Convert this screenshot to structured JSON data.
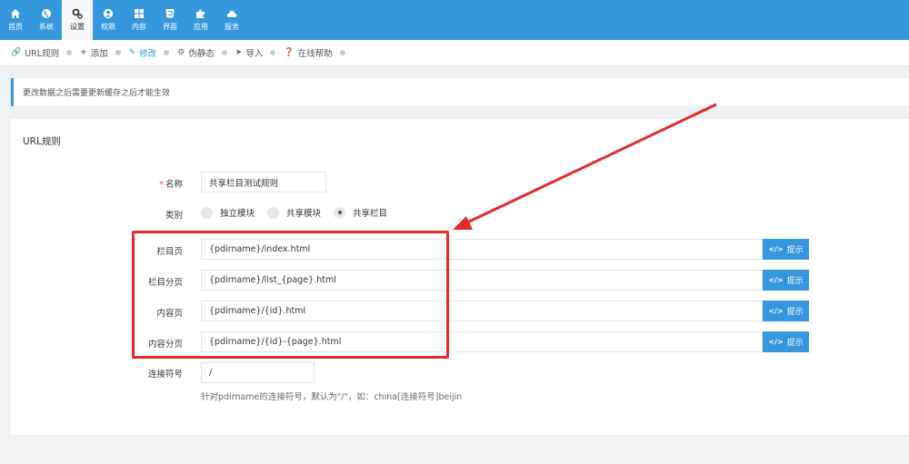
{
  "nav": {
    "items": [
      {
        "label": "首页",
        "icon": "home-icon"
      },
      {
        "label": "系统",
        "icon": "globe-icon"
      },
      {
        "label": "设置",
        "icon": "gears-icon",
        "active": true
      },
      {
        "label": "权限",
        "icon": "user-icon"
      },
      {
        "label": "内容",
        "icon": "grid-icon"
      },
      {
        "label": "界面",
        "icon": "html5-icon"
      },
      {
        "label": "应用",
        "icon": "puzzle-icon"
      },
      {
        "label": "服务",
        "icon": "cloud-icon"
      }
    ]
  },
  "toolbar": {
    "items": [
      {
        "label": "URL规则",
        "icon": "link-icon"
      },
      {
        "label": "添加",
        "icon": "plus-icon"
      },
      {
        "label": "修改",
        "icon": "edit-icon",
        "active": true
      },
      {
        "label": "伪静态",
        "icon": "cog-icon"
      },
      {
        "label": "导入",
        "icon": "sign-in-icon"
      },
      {
        "label": "在线帮助",
        "icon": "question-icon"
      }
    ]
  },
  "notice": "更改数据之后需要更新缓存之后才能生效",
  "panel": {
    "title": "URL规则",
    "name_label": "名称",
    "name_value": "共享栏目测试规则",
    "type_label": "类别",
    "type_options": [
      "独立模块",
      "共享模块",
      "共享栏目"
    ],
    "type_selected": "共享栏目",
    "rules": [
      {
        "label": "栏目页",
        "value": "{pdirname}/index.html",
        "button": "提示"
      },
      {
        "label": "栏目分页",
        "value": "{pdirname}/list_{page}.html",
        "button": "提示"
      },
      {
        "label": "内容页",
        "value": "{pdirname}/{id}.html",
        "button": "提示"
      },
      {
        "label": "内容分页",
        "value": "{pdirname}/{id}-{page}.html",
        "button": "提示"
      }
    ],
    "separator_label": "连接符号",
    "separator_value": "/",
    "separator_help": "针对pdirname的连接符号，默认为\"/\"，如：china[连接符号]beijin"
  },
  "colors": {
    "primary": "#3598dc",
    "annotation": "#e32a2a",
    "required": "#e7505a"
  }
}
